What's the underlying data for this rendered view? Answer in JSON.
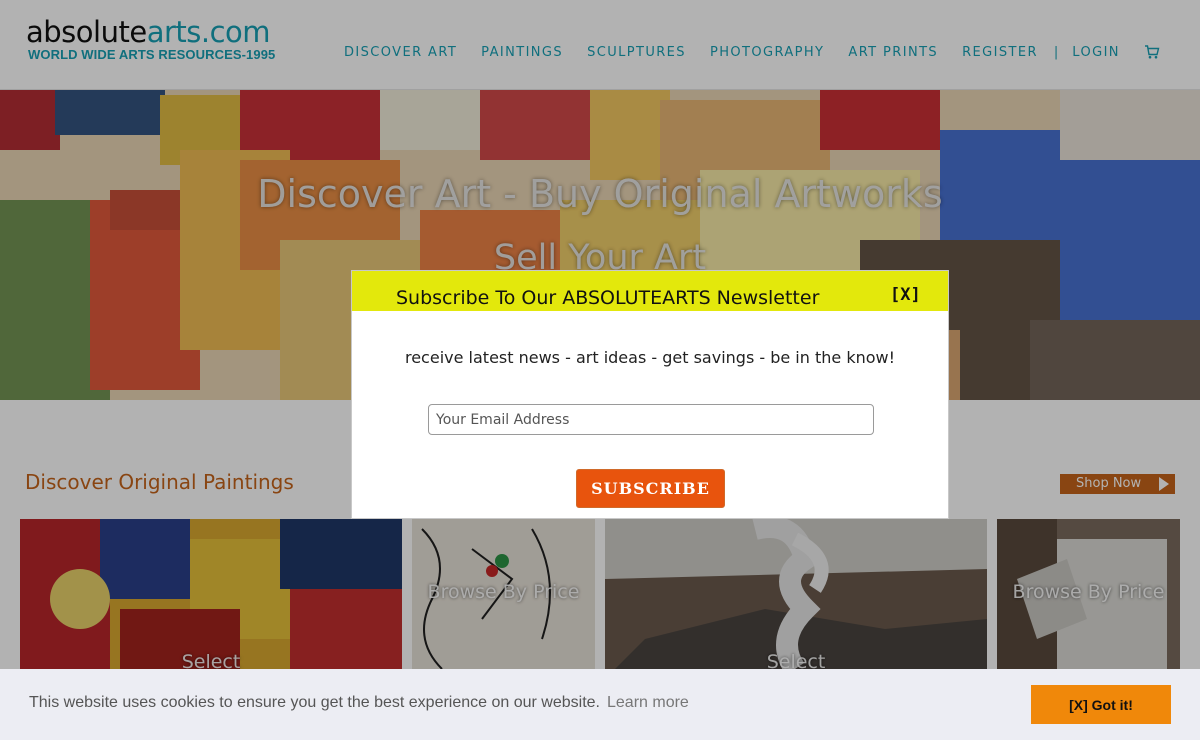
{
  "logo": {
    "part1": "absolute",
    "part2": "arts.com",
    "tagline": "WORLD WIDE ARTS RESOURCES-1995"
  },
  "nav": {
    "items": [
      "DISCOVER ART",
      "PAINTINGS",
      "SCULPTURES",
      "PHOTOGRAPHY",
      "ART PRINTS",
      "REGISTER"
    ],
    "separator": "|",
    "login": "LOGIN",
    "cart_icon": "cart-icon"
  },
  "hero": {
    "title": "Discover Art - Buy Original Artworks",
    "subtitle": "Sell Your Art"
  },
  "section": {
    "title": "Discover Original Paintings",
    "shop_now": "Shop Now"
  },
  "tiles": [
    {
      "label": "Select"
    },
    {
      "label": "Browse By Price"
    },
    {
      "label": "Select"
    },
    {
      "label": "Browse By Price"
    }
  ],
  "modal": {
    "title": "Subscribe To Our ABSOLUTEARTS Newsletter",
    "close": "[X]",
    "text": "receive latest news - art ideas - get savings - be in the know!",
    "email_placeholder": "Your Email Address",
    "subscribe": "SUBSCRIBE"
  },
  "cookie": {
    "text": "This website uses cookies to ensure you get the best experience on our website.",
    "learn_more": "Learn more",
    "got_it": "[X] Got it!"
  },
  "colors": {
    "accent": "#17a0b4",
    "section_orange": "#c5641a",
    "modal_header": "#e3e80c",
    "subscribe_button": "#e8540d",
    "cookie_button": "#f0880a"
  }
}
